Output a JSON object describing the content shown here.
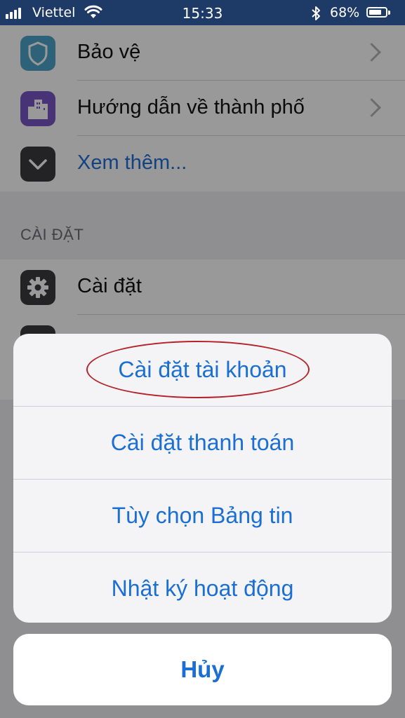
{
  "status_bar": {
    "carrier": "Viettel",
    "time": "15:33",
    "battery_percent": "68%",
    "battery_level": 0.68
  },
  "menu": {
    "items": [
      {
        "label": "Bảo vệ",
        "icon": "shield-icon",
        "color": "#4ea3c9"
      },
      {
        "label": "Hướng dẫn về thành phố",
        "icon": "city-guide-icon",
        "color": "#7a55c7"
      },
      {
        "label": "Xem thêm...",
        "icon": "chevron-down-icon",
        "color": "#3b3b40"
      }
    ]
  },
  "settings_section": {
    "header": "CÀI ĐẶT",
    "items": [
      {
        "label": "Cài đặt",
        "icon": "gear-icon",
        "color": "#3b3b40"
      }
    ]
  },
  "action_sheet": {
    "items": [
      {
        "label": "Cài đặt tài khoản",
        "highlighted": true
      },
      {
        "label": "Cài đặt thanh toán"
      },
      {
        "label": "Tùy chọn Bảng tin"
      },
      {
        "label": "Nhật ký hoạt động"
      }
    ],
    "cancel_label": "Hủy",
    "accent_color": "#1b6fd4",
    "highlight_color": "#b3232a"
  }
}
